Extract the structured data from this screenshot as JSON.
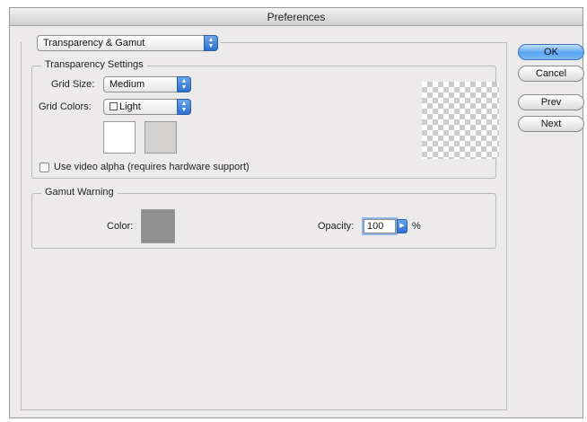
{
  "window": {
    "title": "Preferences"
  },
  "section_popup": {
    "value": "Transparency & Gamut"
  },
  "transparency": {
    "legend": "Transparency Settings",
    "grid_size_label": "Grid Size:",
    "grid_size_value": "Medium",
    "grid_colors_label": "Grid Colors:",
    "grid_colors_value": "Light",
    "swatch_1_color": "#ffffff",
    "swatch_2_color": "#d4d2d1",
    "video_alpha_label": "Use video alpha (requires hardware support)",
    "video_alpha_checked": false
  },
  "gamut": {
    "legend": "Gamut Warning",
    "color_label": "Color:",
    "color_value": "#8f8f8f",
    "opacity_label": "Opacity:",
    "opacity_value": "100",
    "opacity_unit": "%"
  },
  "buttons": {
    "ok": "OK",
    "cancel": "Cancel",
    "prev": "Prev",
    "next": "Next"
  },
  "icons": {
    "popup_arrows": "up-down-arrows-icon",
    "stepper_arrow": "right-arrow-icon"
  }
}
